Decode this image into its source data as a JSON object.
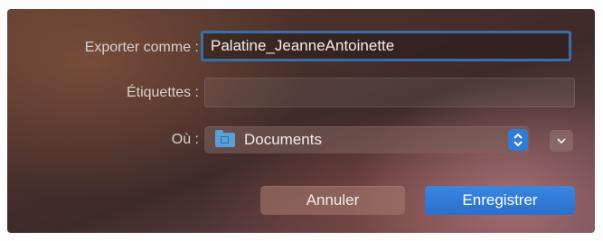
{
  "labels": {
    "export_as": "Exporter comme :",
    "tags": "Étiquettes :",
    "where": "Où :"
  },
  "export_field": {
    "value": "Palatine_JeanneAntoinette"
  },
  "tags_field": {
    "value": ""
  },
  "location_popup": {
    "value": "Documents",
    "icon": "folder-icon",
    "accent": "#2f7bd6"
  },
  "buttons": {
    "cancel": "Annuler",
    "save": "Enregistrer",
    "save_color": "#2a6fcc"
  }
}
